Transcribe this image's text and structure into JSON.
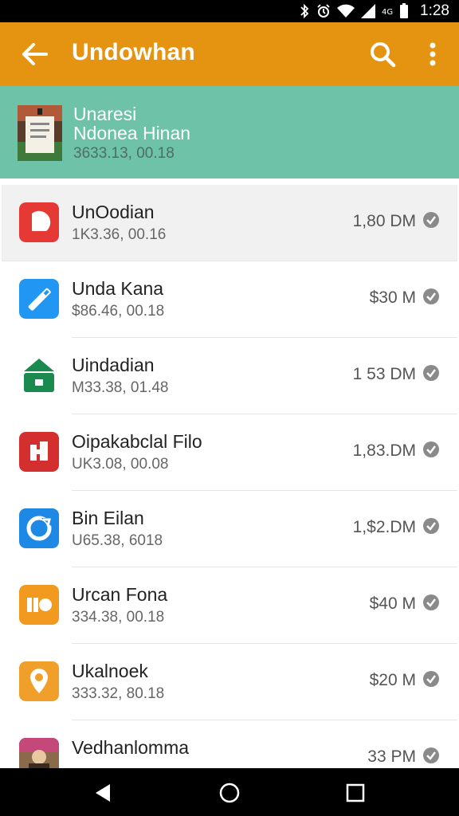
{
  "status_bar": {
    "time": "1:28"
  },
  "app_bar": {
    "title": "Undowhan",
    "back_icon": "arrow-left-icon",
    "search_icon": "search-icon",
    "more_icon": "more-vert-icon"
  },
  "header": {
    "line1": "Unaresi",
    "line2": "Ndonea Hinan",
    "line3": "3633.13, 00.18"
  },
  "items": [
    {
      "title": "UnOodian",
      "sub": "1K3.36, 00.16",
      "size": "1,80 DM",
      "icon": "shape-icon",
      "color": "#e53935"
    },
    {
      "title": "Unda Kana",
      "sub": "$86.46, 00.18",
      "size": "$30 M",
      "icon": "usb-icon",
      "color": "#2196f3"
    },
    {
      "title": "Uindadian",
      "sub": "M33.38, 01.48",
      "size": "1 53 DM",
      "icon": "house-bag-icon",
      "color": "#1b8a4f"
    },
    {
      "title": "Oipakabclal Filo",
      "sub": "UK3.08, 00.08",
      "size": "1,83.DM",
      "icon": "film-icon",
      "color": "#d32f2f"
    },
    {
      "title": "Bin Eilan",
      "sub": "U65.38, 6018",
      "size": "1,$2.DM",
      "icon": "circle-arrow-icon",
      "color": "#1e88e5"
    },
    {
      "title": "Urcan Fona",
      "sub": "334.38, 00.18",
      "size": "$40 M",
      "icon": "folder-icon",
      "color": "#f19a1f"
    },
    {
      "title": "Ukalnoek",
      "sub": "333.32, 80.18",
      "size": "$20 M",
      "icon": "location-pin-icon",
      "color": "#f0a02a"
    },
    {
      "title": "Vedhanlomma",
      "sub": "",
      "size": "33 PM",
      "icon": "photo-thumb-icon",
      "color": "#8a6a4a"
    }
  ],
  "nav": {
    "back_icon": "nav-back-icon",
    "home_icon": "nav-home-icon",
    "recents_icon": "nav-recents-icon"
  }
}
